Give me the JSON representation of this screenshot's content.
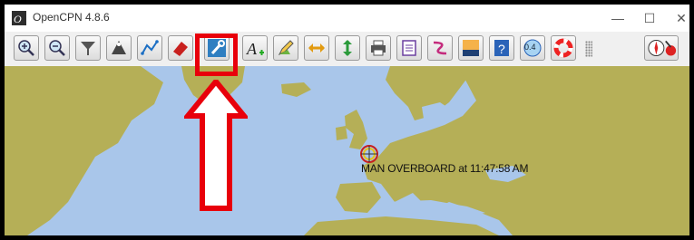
{
  "window": {
    "title": "OpenCPN 4.8.6",
    "controls": [
      "—",
      "☐",
      "✕"
    ]
  },
  "toolbar": {
    "buttons": [
      {
        "name": "zoom-in",
        "icon": "magnifier-plus-icon"
      },
      {
        "name": "zoom-out",
        "icon": "magnifier-minus-icon"
      },
      {
        "name": "scale-in",
        "icon": "funnel-icon"
      },
      {
        "name": "scale-out",
        "icon": "ship-triangle-icon"
      },
      {
        "name": "route",
        "icon": "route-icon"
      },
      {
        "name": "track",
        "icon": "eraser-icon"
      },
      {
        "name": "options",
        "icon": "wrench-icon",
        "highlighted": true
      },
      {
        "name": "text",
        "icon": "text-icon"
      },
      {
        "name": "draw",
        "icon": "pencil-icon"
      },
      {
        "name": "north-up",
        "icon": "arrows-horizontal-icon"
      },
      {
        "name": "course-up",
        "icon": "arrows-vertical-icon"
      },
      {
        "name": "print",
        "icon": "printer-icon"
      },
      {
        "name": "route-manager",
        "icon": "clipboard-icon"
      },
      {
        "name": "tides",
        "icon": "curve-icon"
      },
      {
        "name": "chart-quilt",
        "icon": "chart-icon"
      },
      {
        "name": "help",
        "icon": "help-icon"
      },
      {
        "name": "ais",
        "icon": "ais-icon"
      },
      {
        "name": "mob",
        "icon": "lifebuoy-icon"
      }
    ],
    "ais_label": "0.4"
  },
  "map": {
    "mob_label": "MAN OVERBOARD at 11:47:58 AM",
    "colors": {
      "water": "#a9c6ea",
      "land": "#b5af57",
      "highlight": "#e8000b"
    }
  }
}
